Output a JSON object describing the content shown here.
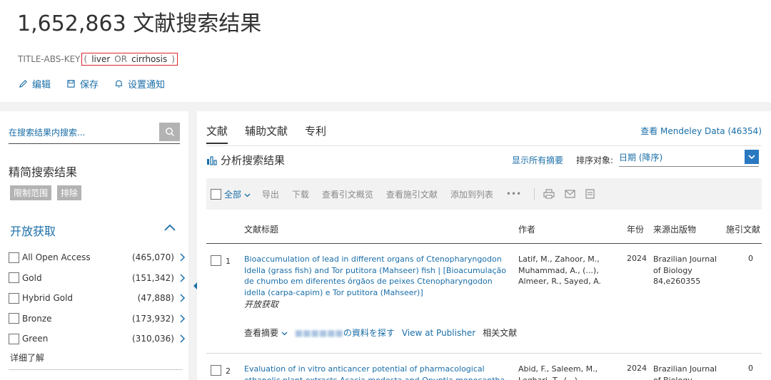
{
  "header": {
    "title": "1,652,863 文献搜索结果",
    "query_prefix": "TITLE-ABS-KEY",
    "query_open": "(",
    "query_term1": "liver",
    "query_op": "OR",
    "query_term2": "cirrhosis",
    "query_close": ")",
    "actions": [
      {
        "label": "编辑",
        "icon": "pencil-icon"
      },
      {
        "label": "保存",
        "icon": "save-icon"
      },
      {
        "label": "设置通知",
        "icon": "bell-icon"
      }
    ]
  },
  "sidebar": {
    "search_placeholder": "在搜索结果内搜索...",
    "refine_title": "精简搜索结果",
    "limit_label": "限制范围",
    "exclude_label": "排除",
    "open_access_title": "开放获取",
    "open_access_items": [
      {
        "label": "All Open Access",
        "count": "(465,070)"
      },
      {
        "label": "Gold",
        "count": "(151,342)"
      },
      {
        "label": "Hybrid Gold",
        "count": "(47,888)"
      },
      {
        "label": "Bronze",
        "count": "(173,932)"
      },
      {
        "label": "Green",
        "count": "(310,036)"
      }
    ],
    "learn_more": "详细了解"
  },
  "main": {
    "tabs": [
      "文献",
      "辅助文献",
      "专利"
    ],
    "active_tab": "文献",
    "mendeley": "查看 Mendeley Data (46354)",
    "analyze": "分析搜索结果",
    "show_abstracts": "显示所有摘要",
    "sort_label": "排序对象:",
    "sort_value": "日期 (降序)",
    "toolbar": {
      "all": "全部",
      "export": "导出",
      "download": "下载",
      "citation_overview": "查看引文概览",
      "cited_by": "查看施引文献",
      "add_to_list": "添加到列表",
      "more": "•••"
    },
    "columns": {
      "title": "文献标题",
      "authors": "作者",
      "year": "年份",
      "source": "来源出版物",
      "cited_by": "施引文献"
    },
    "results": [
      {
        "num": "1",
        "title": "Bioaccumulation of lead in different organs of Ctenopharyngodon Idella (grass fish) and Tor putitora (Mahseer) fish | [Bioacumulação de chumbo em diferentes órgãos de peixes Ctenopharyngodon idella (carpa-capim) e Tor putitora (Mahseer)]",
        "authors": "Latif, M., Zahoor, M., Muhammad, A., (...), Almeer, R., Sayed, A.",
        "year": "2024",
        "source": "Brazilian Journal of Biology 84,e260355",
        "cites": "0",
        "oa": "开放获取",
        "view_abstract": "查看摘要",
        "library_link": "の資料を探す",
        "publisher_link": "View at Publisher",
        "related": "相关文献"
      },
      {
        "num": "2",
        "title": "Evaluation of in vitro anticancer potential of pharmacological ethanolic plant extracts Acacia modesta and Opuntia monocantha against liver",
        "authors": "Abid, F., Saleem, M., Leghari, T., (...), Mobashar,",
        "year": "2024",
        "source": "Brazilian Journal of Biology",
        "cites": "0"
      }
    ]
  }
}
